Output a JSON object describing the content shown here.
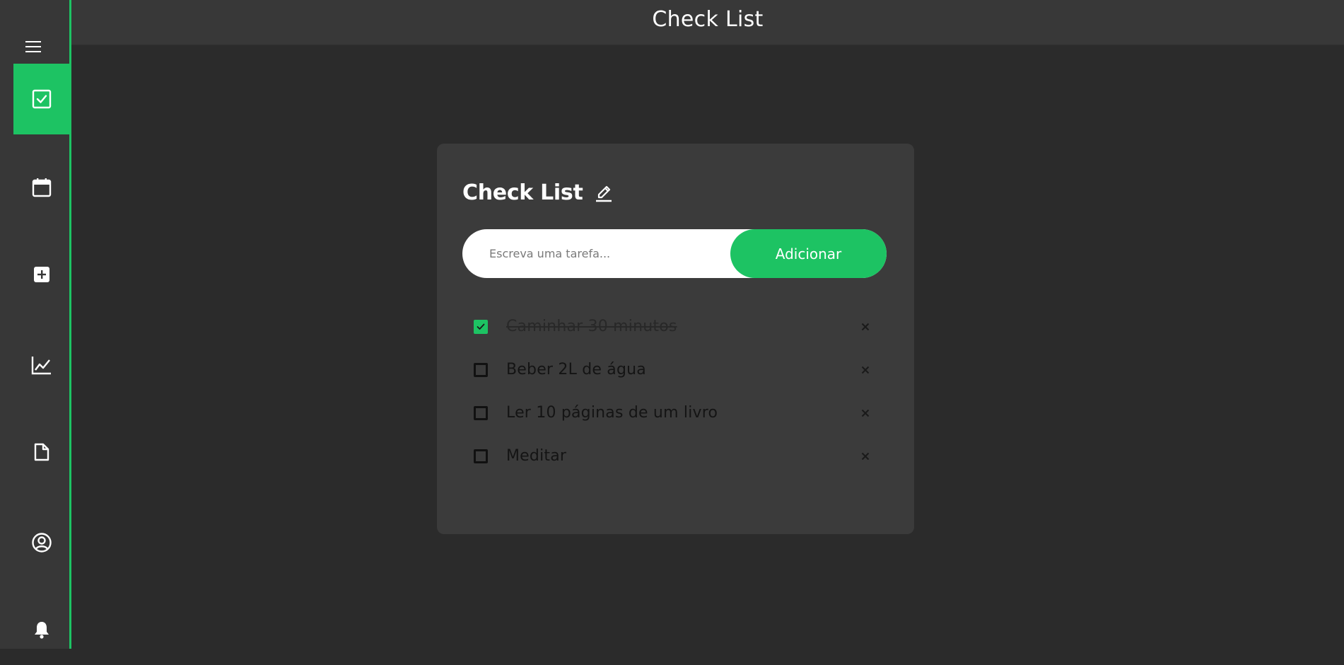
{
  "header": {
    "title": "Check List"
  },
  "sidebar": {
    "menu_icon": "hamburger-menu-icon",
    "items": [
      {
        "id": "checklist",
        "icon": "checkbox-icon",
        "active": true
      },
      {
        "id": "calendar",
        "icon": "calendar-icon",
        "active": false
      },
      {
        "id": "add",
        "icon": "plus-square-icon",
        "active": false
      },
      {
        "id": "stats",
        "icon": "line-chart-icon",
        "active": false
      },
      {
        "id": "document",
        "icon": "file-icon",
        "active": false
      },
      {
        "id": "profile",
        "icon": "user-circle-icon",
        "active": false
      },
      {
        "id": "notifications",
        "icon": "bell-icon",
        "active": false
      }
    ]
  },
  "card": {
    "title": "Check List",
    "edit_icon": "pencil-icon",
    "input": {
      "placeholder": "Escreva uma tarefa...",
      "value": ""
    },
    "add_button_label": "Adicionar",
    "tasks": [
      {
        "text": "Caminhar 30 minutos",
        "done": true
      },
      {
        "text": "Beber 2L de água",
        "done": false
      },
      {
        "text": "Ler 10 páginas de um livro",
        "done": false
      },
      {
        "text": "Meditar",
        "done": false
      }
    ]
  },
  "colors": {
    "accent": "#1dc363",
    "sidebar_bg": "#373737",
    "topbar_bg": "#383838",
    "page_bg": "#2b2b2b",
    "card_bg": "#3b3b3b"
  }
}
